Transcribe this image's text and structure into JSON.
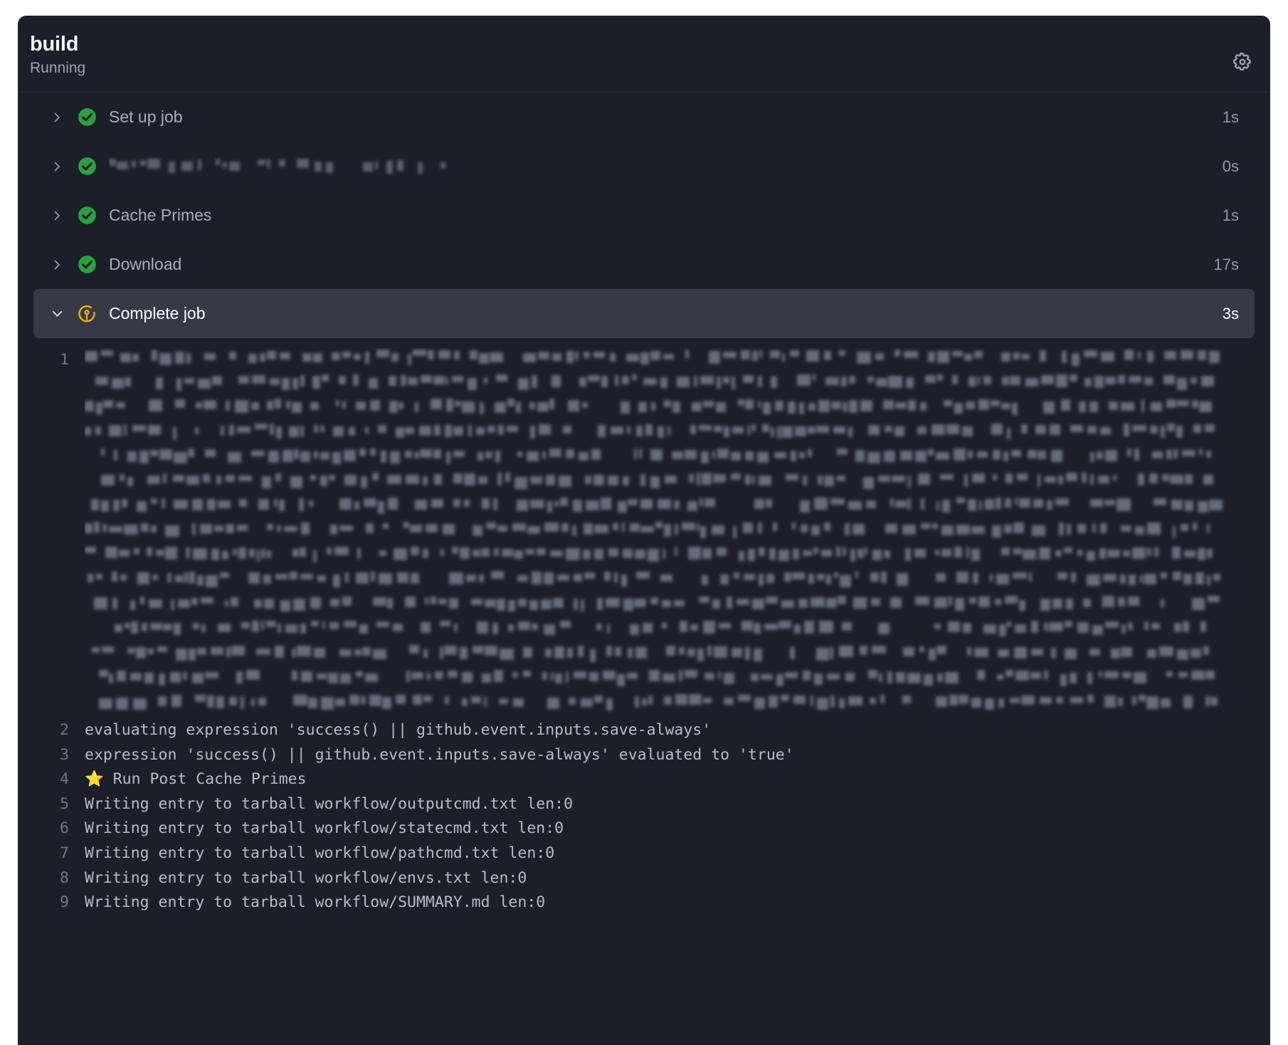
{
  "header": {
    "title": "build",
    "status": "Running",
    "settings_icon": "gear-icon"
  },
  "steps": [
    {
      "name": "Set up job",
      "duration": "1s",
      "state": "success",
      "expanded": false,
      "redacted": false
    },
    {
      "name": "",
      "duration": "0s",
      "state": "success",
      "expanded": false,
      "redacted": true
    },
    {
      "name": "Cache Primes",
      "duration": "1s",
      "state": "success",
      "expanded": false,
      "redacted": false
    },
    {
      "name": "Download",
      "duration": "17s",
      "state": "success",
      "expanded": false,
      "redacted": false
    },
    {
      "name": "Complete job",
      "duration": "3s",
      "state": "in_progress",
      "expanded": true,
      "redacted": false
    }
  ],
  "log": {
    "lines": [
      {
        "number": "1",
        "text": "",
        "redacted": true
      },
      {
        "number": "2",
        "text": "evaluating expression 'success() || github.event.inputs.save-always'",
        "redacted": false
      },
      {
        "number": "3",
        "text": "expression 'success() || github.event.inputs.save-always' evaluated to 'true'",
        "redacted": false
      },
      {
        "number": "4",
        "text": "⭐ Run Post Cache Primes",
        "redacted": false,
        "star": true
      },
      {
        "number": "5",
        "text": "Writing entry to tarball workflow/outputcmd.txt len:0",
        "redacted": false
      },
      {
        "number": "6",
        "text": "Writing entry to tarball workflow/statecmd.txt len:0",
        "redacted": false
      },
      {
        "number": "7",
        "text": "Writing entry to tarball workflow/pathcmd.txt len:0",
        "redacted": false
      },
      {
        "number": "8",
        "text": "Writing entry to tarball workflow/envs.txt len:0",
        "redacted": false
      },
      {
        "number": "9",
        "text": "Writing entry to tarball workflow/SUMMARY.md len:0",
        "redacted": false
      }
    ]
  },
  "colors": {
    "panel_bg": "#1c1f29",
    "active_row_bg": "#363a46",
    "success_green": "#2ea043",
    "in_progress_amber": "#f0ad0c",
    "text_primary": "#ffffff",
    "text_muted": "#9199ab",
    "log_text": "#b7bdc9",
    "line_number": "#6e7787",
    "star_yellow": "#f0b429"
  }
}
